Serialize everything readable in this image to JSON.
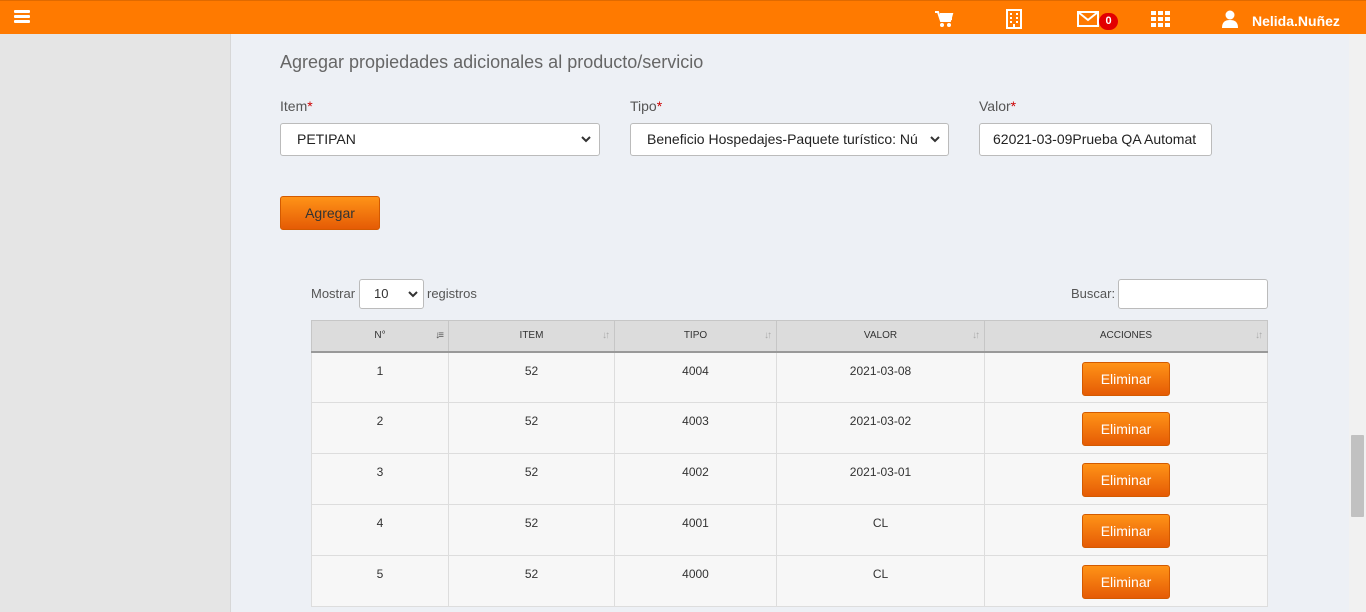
{
  "header": {
    "username": "Nelida.Nuñez",
    "mail_count": "0",
    "icons": [
      "menu-icon",
      "cart-icon",
      "building-icon",
      "mail-icon",
      "apps-grid-icon",
      "user-icon"
    ]
  },
  "form": {
    "title": "Agregar propiedades adicionales al producto/servicio",
    "item_label": "Item",
    "tipo_label": "Tipo",
    "valor_label": "Valor",
    "required_mark": "*",
    "item_value": "PETIPAN",
    "tipo_value": "Beneficio Hospedajes-Paquete turístico: Nú",
    "valor_value": "62021-03-09Prueba QA Automat",
    "add_button": "Agregar"
  },
  "table_controls": {
    "show_label": "Mostrar",
    "page_length": "10",
    "records_label": "registros",
    "search_label": "Buscar:"
  },
  "table": {
    "columns": [
      "N°",
      "ITEM",
      "TIPO",
      "VALOR",
      "ACCIONES"
    ],
    "delete_label": "Eliminar",
    "rows": [
      {
        "n": "1",
        "item": "52",
        "tipo": "4004",
        "valor": "2021-03-08"
      },
      {
        "n": "2",
        "item": "52",
        "tipo": "4003",
        "valor": "2021-03-02"
      },
      {
        "n": "3",
        "item": "52",
        "tipo": "4002",
        "valor": "2021-03-01"
      },
      {
        "n": "4",
        "item": "52",
        "tipo": "4001",
        "valor": "CL"
      },
      {
        "n": "5",
        "item": "52",
        "tipo": "4000",
        "valor": "CL"
      }
    ]
  },
  "colors": {
    "topbar": "#ff7a00",
    "button": "#f06f0b",
    "badge": "#e30000"
  }
}
